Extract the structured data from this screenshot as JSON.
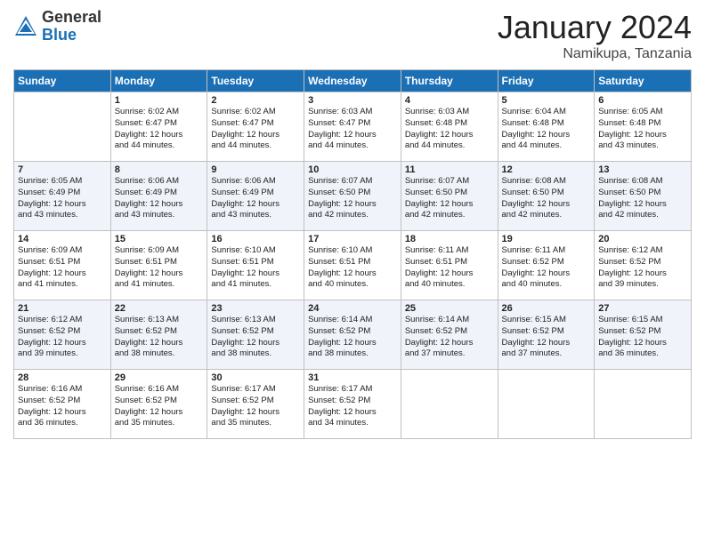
{
  "header": {
    "logo_general": "General",
    "logo_blue": "Blue",
    "month_title": "January 2024",
    "location": "Namikupa, Tanzania"
  },
  "days_of_week": [
    "Sunday",
    "Monday",
    "Tuesday",
    "Wednesday",
    "Thursday",
    "Friday",
    "Saturday"
  ],
  "weeks": [
    [
      {
        "day": "",
        "info": ""
      },
      {
        "day": "1",
        "info": "Sunrise: 6:02 AM\nSunset: 6:47 PM\nDaylight: 12 hours\nand 44 minutes."
      },
      {
        "day": "2",
        "info": "Sunrise: 6:02 AM\nSunset: 6:47 PM\nDaylight: 12 hours\nand 44 minutes."
      },
      {
        "day": "3",
        "info": "Sunrise: 6:03 AM\nSunset: 6:47 PM\nDaylight: 12 hours\nand 44 minutes."
      },
      {
        "day": "4",
        "info": "Sunrise: 6:03 AM\nSunset: 6:48 PM\nDaylight: 12 hours\nand 44 minutes."
      },
      {
        "day": "5",
        "info": "Sunrise: 6:04 AM\nSunset: 6:48 PM\nDaylight: 12 hours\nand 44 minutes."
      },
      {
        "day": "6",
        "info": "Sunrise: 6:05 AM\nSunset: 6:48 PM\nDaylight: 12 hours\nand 43 minutes."
      }
    ],
    [
      {
        "day": "7",
        "info": ""
      },
      {
        "day": "8",
        "info": "Sunrise: 6:06 AM\nSunset: 6:49 PM\nDaylight: 12 hours\nand 43 minutes."
      },
      {
        "day": "9",
        "info": "Sunrise: 6:06 AM\nSunset: 6:49 PM\nDaylight: 12 hours\nand 43 minutes."
      },
      {
        "day": "10",
        "info": "Sunrise: 6:07 AM\nSunset: 6:50 PM\nDaylight: 12 hours\nand 42 minutes."
      },
      {
        "day": "11",
        "info": "Sunrise: 6:07 AM\nSunset: 6:50 PM\nDaylight: 12 hours\nand 42 minutes."
      },
      {
        "day": "12",
        "info": "Sunrise: 6:08 AM\nSunset: 6:50 PM\nDaylight: 12 hours\nand 42 minutes."
      },
      {
        "day": "13",
        "info": "Sunrise: 6:08 AM\nSunset: 6:50 PM\nDaylight: 12 hours\nand 42 minutes."
      }
    ],
    [
      {
        "day": "14",
        "info": ""
      },
      {
        "day": "15",
        "info": "Sunrise: 6:09 AM\nSunset: 6:51 PM\nDaylight: 12 hours\nand 41 minutes."
      },
      {
        "day": "16",
        "info": "Sunrise: 6:10 AM\nSunset: 6:51 PM\nDaylight: 12 hours\nand 41 minutes."
      },
      {
        "day": "17",
        "info": "Sunrise: 6:10 AM\nSunset: 6:51 PM\nDaylight: 12 hours\nand 40 minutes."
      },
      {
        "day": "18",
        "info": "Sunrise: 6:11 AM\nSunset: 6:51 PM\nDaylight: 12 hours\nand 40 minutes."
      },
      {
        "day": "19",
        "info": "Sunrise: 6:11 AM\nSunset: 6:52 PM\nDaylight: 12 hours\nand 40 minutes."
      },
      {
        "day": "20",
        "info": "Sunrise: 6:12 AM\nSunset: 6:52 PM\nDaylight: 12 hours\nand 39 minutes."
      }
    ],
    [
      {
        "day": "21",
        "info": ""
      },
      {
        "day": "22",
        "info": "Sunrise: 6:13 AM\nSunset: 6:52 PM\nDaylight: 12 hours\nand 38 minutes."
      },
      {
        "day": "23",
        "info": "Sunrise: 6:13 AM\nSunset: 6:52 PM\nDaylight: 12 hours\nand 38 minutes."
      },
      {
        "day": "24",
        "info": "Sunrise: 6:14 AM\nSunset: 6:52 PM\nDaylight: 12 hours\nand 38 minutes."
      },
      {
        "day": "25",
        "info": "Sunrise: 6:14 AM\nSunset: 6:52 PM\nDaylight: 12 hours\nand 37 minutes."
      },
      {
        "day": "26",
        "info": "Sunrise: 6:15 AM\nSunset: 6:52 PM\nDaylight: 12 hours\nand 37 minutes."
      },
      {
        "day": "27",
        "info": "Sunrise: 6:15 AM\nSunset: 6:52 PM\nDaylight: 12 hours\nand 36 minutes."
      }
    ],
    [
      {
        "day": "28",
        "info": "Sunrise: 6:16 AM\nSunset: 6:52 PM\nDaylight: 12 hours\nand 36 minutes."
      },
      {
        "day": "29",
        "info": "Sunrise: 6:16 AM\nSunset: 6:52 PM\nDaylight: 12 hours\nand 35 minutes."
      },
      {
        "day": "30",
        "info": "Sunrise: 6:17 AM\nSunset: 6:52 PM\nDaylight: 12 hours\nand 35 minutes."
      },
      {
        "day": "31",
        "info": "Sunrise: 6:17 AM\nSunset: 6:52 PM\nDaylight: 12 hours\nand 34 minutes."
      },
      {
        "day": "",
        "info": ""
      },
      {
        "day": "",
        "info": ""
      },
      {
        "day": "",
        "info": ""
      }
    ]
  ],
  "week7_sunday": "Sunrise: 6:05 AM\nSunset: 6:49 PM\nDaylight: 12 hours\nand 43 minutes.",
  "week14_sunday": "Sunrise: 6:09 AM\nSunset: 6:51 PM\nDaylight: 12 hours\nand 41 minutes.",
  "week21_sunday": "Sunrise: 6:12 AM\nSunset: 6:52 PM\nDaylight: 12 hours\nand 39 minutes."
}
